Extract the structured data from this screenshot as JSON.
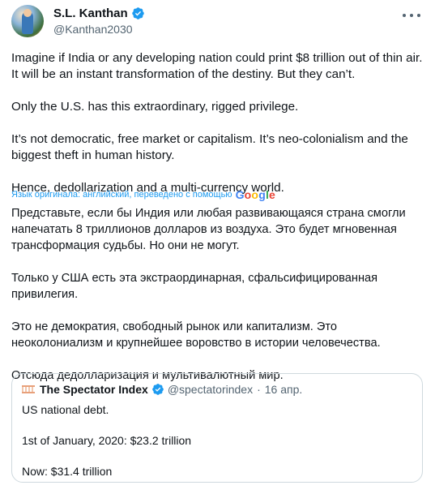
{
  "author": {
    "name": "S.L. Kanthan",
    "handle": "@Kanthan2030"
  },
  "tweet": {
    "paragraphs": [
      "Imagine if India or any developing nation could print $8 trillion out of thin air. It will be an instant transformation of the destiny. But they can’t.",
      "Only the U.S. has this extraordinary, rigged privilege.",
      "It’s not democratic, free market or capitalism. It’s neo-colonialism and the biggest theft in human history.",
      "Hence, dedollarization and a multi-currency world."
    ]
  },
  "translation": {
    "note": "Язык оригинала: английский, переведено с помощью",
    "provider": "Google",
    "paragraphs": [
      "Представьте, если бы Индия или любая развивающаяся страна смогли напечатать 8 триллионов долларов из воздуха. Это будет мгновенная трансформация судьбы. Но они не могут.",
      "Только у США есть эта экстраординарная, сфальсифицированная привилегия.",
      "Это не демократия, свободный рынок или капитализм. Это неоколониализм и крупнейшее воровство в истории человечества.",
      "Отсюда дедолларизация и мультивалютный мир."
    ]
  },
  "quote": {
    "name": "The Spectator Index",
    "handle": "@spectatorindex",
    "dot": "·",
    "date": "16 апр.",
    "lines": [
      "US national debt.",
      "1st of January, 2020: $23.2 trillion",
      "Now: $31.4 trillion"
    ]
  },
  "colors": {
    "verified": "#1d9bf0",
    "link": "#1d9bf0",
    "secondary_text": "#536471"
  },
  "icons": [
    "verified-badge-icon",
    "more-icon",
    "google-logo"
  ]
}
